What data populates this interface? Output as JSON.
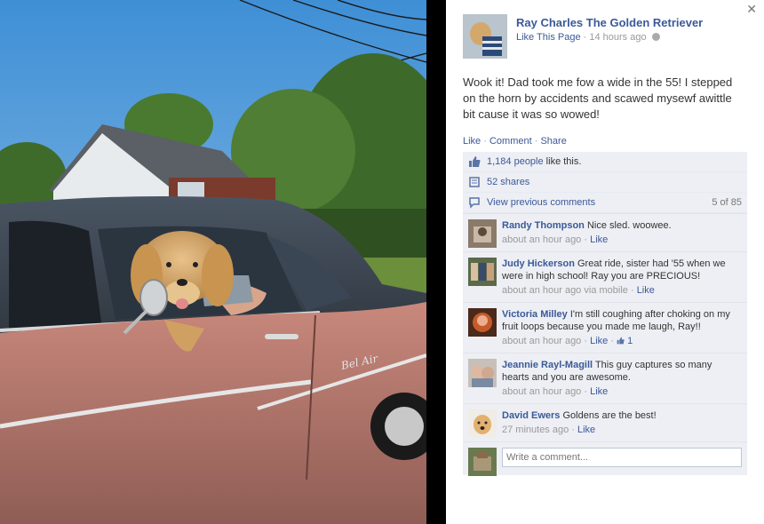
{
  "post": {
    "author_name": "Ray Charles The Golden Retriever",
    "like_page_label": "Like This Page",
    "timestamp": "14 hours ago",
    "text": "Wook it! Dad took me fow a wide in the 55! I stepped on the horn by accidents and scawed mysewf awittle bit cause it was so wowed!",
    "actions": {
      "like": "Like",
      "comment": "Comment",
      "share": "Share"
    }
  },
  "ufi": {
    "likes_link": "1,184 people",
    "likes_suffix": " like this.",
    "shares": "52 shares",
    "view_previous": "View previous comments",
    "comment_count": "5 of 85"
  },
  "comments": [
    {
      "name": "Randy Thompson",
      "text": "Nice sled. woowee.",
      "time": "about an hour ago",
      "like": "Like",
      "via": "",
      "likes": ""
    },
    {
      "name": "Judy Hickerson",
      "text": "Great ride, sister had '55 when we were in high school! Ray you are PRECIOUS!",
      "time": "about an hour ago",
      "like": "Like",
      "via": "via mobile",
      "likes": ""
    },
    {
      "name": "Victoria Milley",
      "text": "I'm still coughing after choking on my fruit loops because you made me laugh, Ray!!",
      "time": "about an hour ago",
      "like": "Like",
      "via": "",
      "likes": "1"
    },
    {
      "name": "Jeannie Rayl-Magill",
      "text": "This guy captures so many hearts and you are awesome.",
      "time": "about an hour ago",
      "like": "Like",
      "via": "",
      "likes": ""
    },
    {
      "name": "David Ewers",
      "text": "Goldens are the best!",
      "time": "27 minutes ago",
      "like": "Like",
      "via": "",
      "likes": ""
    }
  ],
  "composer": {
    "placeholder": "Write a comment..."
  },
  "colors": {
    "link": "#3b5998",
    "ufi_bg": "#edeff4",
    "photo_bg": "#000000"
  },
  "icons": {
    "close": "close-icon",
    "globe": "globe-icon",
    "like": "thumbs-up-icon",
    "share": "share-icon",
    "comment": "comment-bubble-icon"
  }
}
